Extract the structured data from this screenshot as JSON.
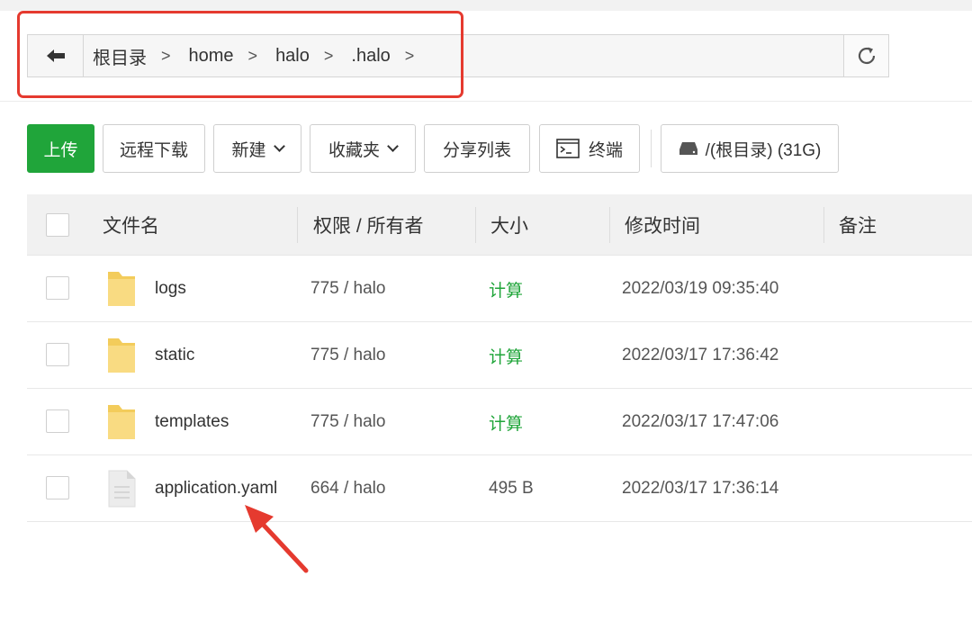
{
  "breadcrumb": {
    "items": [
      "根目录",
      "home",
      "halo",
      ".halo"
    ],
    "separator": ">"
  },
  "toolbar": {
    "upload": "上传",
    "remote_download": "远程下载",
    "new": "新建",
    "favorites": "收藏夹",
    "share_list": "分享列表",
    "terminal": "终端",
    "disk": "/(根目录) (31G)"
  },
  "table": {
    "headers": {
      "name": "文件名",
      "perm": "权限 / 所有者",
      "size": "大小",
      "mtime": "修改时间",
      "note": "备注"
    },
    "rows": [
      {
        "name": "logs",
        "perm": "775 / halo",
        "size": "计算",
        "mtime": "2022/03/19 09:35:40",
        "type": "folder"
      },
      {
        "name": "static",
        "perm": "775 / halo",
        "size": "计算",
        "mtime": "2022/03/17 17:36:42",
        "type": "folder"
      },
      {
        "name": "templates",
        "perm": "775 / halo",
        "size": "计算",
        "mtime": "2022/03/17 17:47:06",
        "type": "folder"
      },
      {
        "name": "application.yaml",
        "perm": "664 / halo",
        "size": "495 B",
        "mtime": "2022/03/17 17:36:14",
        "type": "file"
      }
    ]
  },
  "colors": {
    "accent_green": "#20a53a",
    "annotation_red": "#e53a2f",
    "folder_yellow": "#f7d774"
  }
}
